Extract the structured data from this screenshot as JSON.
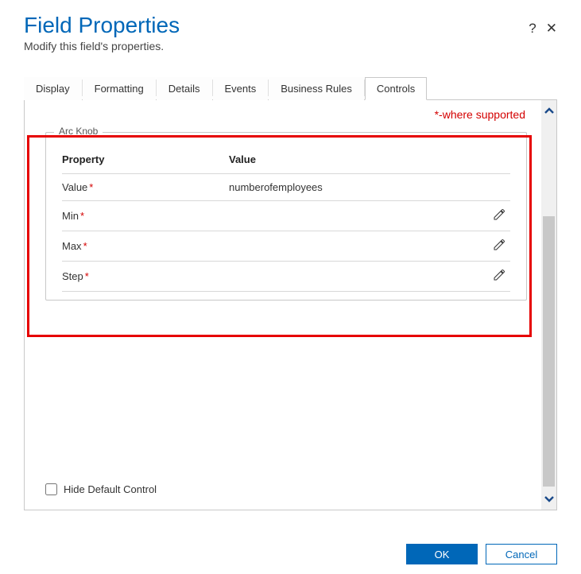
{
  "header": {
    "title": "Field Properties",
    "subtitle": "Modify this field's properties.",
    "help_icon": "?",
    "close_icon": "✕"
  },
  "tabs": [
    {
      "label": "Display",
      "active": false
    },
    {
      "label": "Formatting",
      "active": false
    },
    {
      "label": "Details",
      "active": false
    },
    {
      "label": "Events",
      "active": false
    },
    {
      "label": "Business Rules",
      "active": false
    },
    {
      "label": "Controls",
      "active": true
    }
  ],
  "support_note": "*-where supported",
  "fieldset": {
    "legend": "Arc Knob",
    "columns": {
      "property": "Property",
      "value": "Value"
    },
    "rows": [
      {
        "label": "Value",
        "required": true,
        "value": "numberofemployees",
        "editable": false
      },
      {
        "label": "Min",
        "required": true,
        "value": "",
        "editable": true
      },
      {
        "label": "Max",
        "required": true,
        "value": "",
        "editable": true
      },
      {
        "label": "Step",
        "required": true,
        "value": "",
        "editable": true
      }
    ]
  },
  "required_marker": "*",
  "hide_default_label": "Hide Default Control",
  "buttons": {
    "ok": "OK",
    "cancel": "Cancel"
  }
}
